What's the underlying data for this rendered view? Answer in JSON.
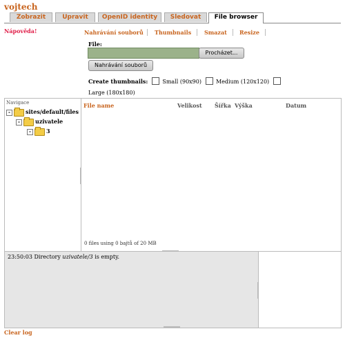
{
  "page": {
    "title": "vojtech"
  },
  "tabs": [
    {
      "label": "Zobrazit",
      "active": false
    },
    {
      "label": "Upravit",
      "active": false
    },
    {
      "label": "OpenID identity",
      "active": false
    },
    {
      "label": "Sledovat",
      "active": false
    },
    {
      "label": "File browser",
      "active": true
    }
  ],
  "help_link": "Nápověda!",
  "subtabs": [
    "Nahrávání souborů",
    "Thumbnails",
    "Smazat",
    "Resize"
  ],
  "upload": {
    "file_label": "File:",
    "browse_label": "Procházet...",
    "upload_button": "Nahrávání souborů",
    "thumbs_label": "Create thumbnails:",
    "thumb_options": [
      {
        "label": "Small (90x90)",
        "checked": false
      },
      {
        "label": "Medium (120x120)",
        "checked": false
      },
      {
        "label": "Large (180x180)",
        "checked": false
      }
    ]
  },
  "navigation": {
    "header": "Navigace",
    "tree": [
      {
        "label": "sites/default/files",
        "toggle": "-",
        "level": 0
      },
      {
        "label": "uzivatele",
        "toggle": "-",
        "level": 1
      },
      {
        "label": "3",
        "toggle": "-",
        "level": 2
      }
    ]
  },
  "listing": {
    "columns": {
      "name": "File name",
      "size": "Velikost",
      "width": "Šířka",
      "height": "Výška",
      "date": "Datum"
    },
    "summary": "0 files using 0 bajtů of 20 MB"
  },
  "log": {
    "time": "23:50:03",
    "pre": "Directory",
    "path": "uzivatele/3",
    "post": "is empty."
  },
  "clear_log": "Clear log"
}
